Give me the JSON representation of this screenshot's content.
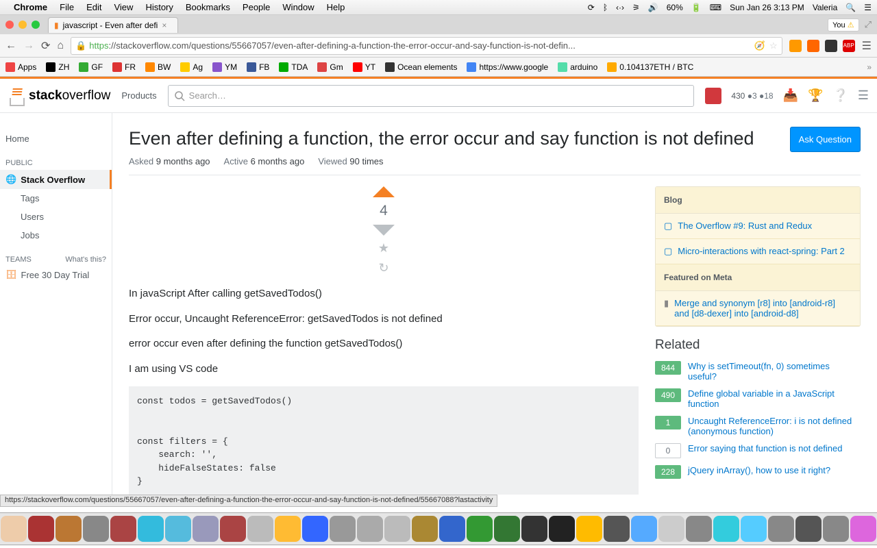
{
  "menubar": {
    "app": "Chrome",
    "items": [
      "File",
      "Edit",
      "View",
      "History",
      "Bookmarks",
      "People",
      "Window",
      "Help"
    ],
    "battery": "60%",
    "datetime": "Sun Jan 26  3:13 PM",
    "user": "Valeria"
  },
  "tab": {
    "title": "javascript - Even after defi",
    "you": "You"
  },
  "address": {
    "https": "https",
    "url": "://stackoverflow.com/questions/55667057/even-after-defining-a-function-the-error-occur-and-say-function-is-not-defin..."
  },
  "ext_icons": [
    "#f90",
    "#f60",
    "#333",
    "#d00"
  ],
  "bookmarks": [
    {
      "label": "Apps",
      "color": "#e44"
    },
    {
      "label": "ZH",
      "color": "#000"
    },
    {
      "label": "GF",
      "color": "#3a3"
    },
    {
      "label": "FR",
      "color": "#d33"
    },
    {
      "label": "BW",
      "color": "#f80"
    },
    {
      "label": "Ag",
      "color": "#fc0"
    },
    {
      "label": "YM",
      "color": "#85c"
    },
    {
      "label": "FB",
      "color": "#3b5998"
    },
    {
      "label": "TDA",
      "color": "#0a0"
    },
    {
      "label": "Gm",
      "color": "#d44"
    },
    {
      "label": "YT",
      "color": "#f00"
    },
    {
      "label": "Ocean elements",
      "color": "#333"
    },
    {
      "label": "https://www.google",
      "color": "#4285f4"
    },
    {
      "label": "arduino",
      "color": "#5da"
    },
    {
      "label": "0.104137ETH / BTC",
      "color": "#fa0"
    }
  ],
  "so": {
    "products": "Products",
    "search_placeholder": "Search…",
    "rep": "430",
    "bronze": "3",
    "gold": "18"
  },
  "sidebar": {
    "home": "Home",
    "public": "PUBLIC",
    "stackoverflow": "Stack Overflow",
    "tags": "Tags",
    "users": "Users",
    "jobs": "Jobs",
    "teams": "TEAMS",
    "whats": "What's this?",
    "trial": "Free 30 Day Trial"
  },
  "question": {
    "title": "Even after defining a function, the error occur and say function is not defined",
    "ask": "Ask Question",
    "asked_label": "Asked",
    "asked": "9 months ago",
    "active_label": "Active",
    "active": "6 months ago",
    "viewed_label": "Viewed",
    "viewed": "90 times",
    "votes": "4",
    "p1": "In javaScript After calling getSavedTodos()",
    "p2": "Error occur, Uncaught ReferenceError: getSavedTodos is not defined",
    "p3": "error occur even after defining the function getSavedTodos()",
    "p4": "I am using VS code",
    "code": "const todos = getSavedTodos()\n\n\nconst filters = {\n    search: '',\n    hideFalseStates: false\n}"
  },
  "widget": {
    "blog": "Blog",
    "blog1": "The Overflow #9: Rust and Redux",
    "blog2": "Micro-interactions with react-spring: Part 2",
    "meta": "Featured on Meta",
    "meta1": "Merge and synonym [r8] into [android-r8] and [d8-dexer] into [android-d8]"
  },
  "related": {
    "title": "Related",
    "items": [
      {
        "count": "844",
        "green": true,
        "text": "Why is setTimeout(fn, 0) sometimes useful?"
      },
      {
        "count": "490",
        "green": true,
        "text": "Define global variable in a JavaScript function"
      },
      {
        "count": "1",
        "green": true,
        "text": "Uncaught ReferenceError: i is not defined (anonymous function)"
      },
      {
        "count": "0",
        "green": false,
        "text": "Error saying that function is not defined"
      },
      {
        "count": "228",
        "green": true,
        "text": "jQuery inArray(), how to use it right?"
      }
    ]
  },
  "status": "https://stackoverflow.com/questions/55667057/even-after-defining-a-function-the-error-occur-and-say-function-is-not-defined/55667088?lastactivity",
  "dock_colors": [
    "#4aa",
    "#888",
    "#e44",
    "#6cf",
    "#fc6",
    "#eca",
    "#a33",
    "#b73",
    "#888",
    "#a44",
    "#3bd",
    "#5bd",
    "#99b",
    "#a44",
    "#bbb",
    "#fb3",
    "#36f",
    "#999",
    "#aaa",
    "#bbb",
    "#a83",
    "#36c",
    "#393",
    "#373",
    "#333",
    "#222",
    "#fb0",
    "#555",
    "#5af",
    "#ccc",
    "#888",
    "#3cd",
    "#5cf",
    "#888",
    "#555",
    "#888",
    "#d6d",
    "#f9b",
    "#ccc",
    "#888",
    "#ccc",
    "#888"
  ]
}
